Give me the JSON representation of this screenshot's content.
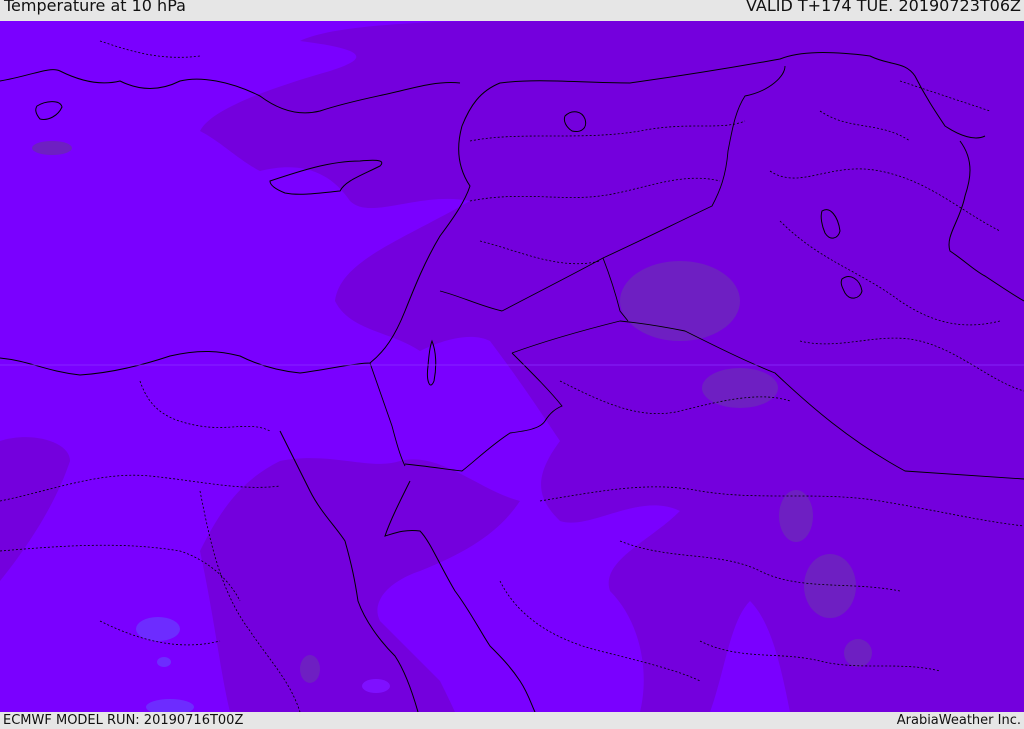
{
  "header": {
    "title": "Temperature at 10 hPa",
    "valid": "VALID T+174 TUE. 20190723T06Z"
  },
  "footer": {
    "model_run": "ECMWF MODEL RUN: 20190716T00Z",
    "credit": "ArabiaWeather Inc."
  },
  "map": {
    "colors": {
      "field_light": "#7a00ff",
      "field_mid": "#7400dd",
      "field_dark": "#6e1fc2",
      "field_blue": "#6d2cff",
      "boundary": "#000000"
    }
  }
}
